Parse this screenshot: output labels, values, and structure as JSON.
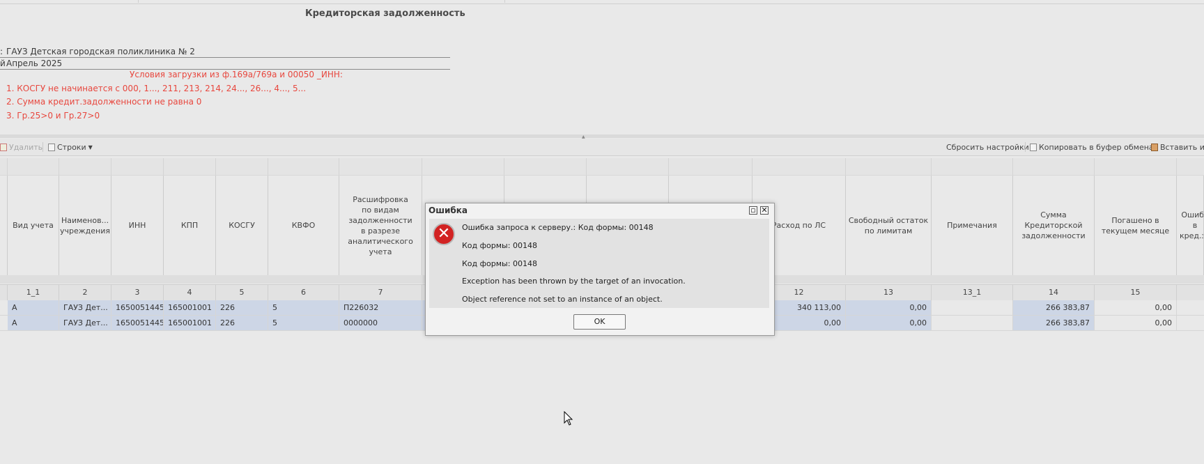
{
  "report": {
    "title": "Кредиторская задолженность",
    "org_label_fragment": ":",
    "org_value": "ГАУЗ Детская городская поликлиника № 2",
    "period_label_fragment": "й",
    "period_value": "Апрель 2025"
  },
  "conditions": {
    "heading": "Условия загрузки из ф.169а/769а и 00050 _ИНН:",
    "items": [
      "1. КОСГУ не начинается с 000, 1..., 211, 213, 214, 24..., 26..., 4..., 5...",
      "2. Сумма кредит.задолженности не равна 0",
      "3. Гр.25>0 и Гр.27>0"
    ]
  },
  "toolbar": {
    "delete_label": "Удалить",
    "rows_label": "Строки",
    "reset_label": "Сбросить настройки",
    "copy_label": "Копировать в буфер обмена",
    "paste_label": "Вставить и"
  },
  "table": {
    "headers": [
      "Вид учета",
      "Наименов... учреждения",
      "ИНН",
      "КПП",
      "КОСГУ",
      "КВФО",
      "Расшифровка по видам задолженности в разрезе аналитического учета",
      "Расход по ЛС",
      "Свободный остаток по лимитам",
      "Примечания",
      "Сумма Кредиторской задолженности",
      "Погашено в текущем месяце",
      "Ошибо в кред.за"
    ],
    "numbers": [
      "1_1",
      "2",
      "3",
      "4",
      "5",
      "6",
      "7",
      "12",
      "13",
      "13_1",
      "14",
      "15"
    ],
    "rows": [
      {
        "vid": "А",
        "name": "ГАУЗ Дет...",
        "inn": "1650051445",
        "kpp": "165001001",
        "kosgu": "226",
        "kvfo": "5",
        "rasshifrovka": "П226032",
        "rashod": "340 113,00",
        "ostatok": "0,00",
        "primechaniya": "",
        "summa": "266 383,87",
        "pogasheno": "0,00"
      },
      {
        "vid": "А",
        "name": "ГАУЗ Дет...",
        "inn": "1650051445",
        "kpp": "165001001",
        "kosgu": "226",
        "kvfo": "5",
        "rasshifrovka": "0000000",
        "rashod": "0,00",
        "ostatok": "0,00",
        "primechaniya": "",
        "summa": "266 383,87",
        "pogasheno": "0,00"
      }
    ]
  },
  "dialog": {
    "title": "Ошибка",
    "messages": [
      "Ошибка запроса к серверу.: Код формы: 00148",
      "Код формы: 00148",
      "Код формы: 00148",
      "Exception has been thrown by the target of an invocation.",
      "Object reference not set to an instance of an object."
    ],
    "ok_label": "OK",
    "error_icon_color": "#d22323"
  },
  "colors": {
    "condition_text": "#e8473e",
    "selected_cell": "#cdd6e6"
  }
}
